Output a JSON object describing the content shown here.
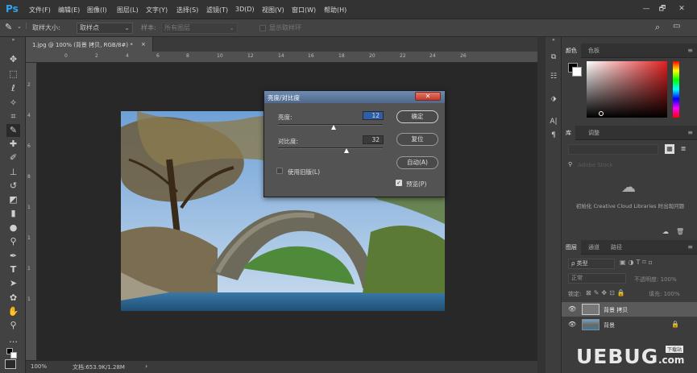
{
  "app": {
    "logo": "Ps"
  },
  "menu": [
    "文件(F)",
    "编辑(E)",
    "图像(I)",
    "图层(L)",
    "文字(Y)",
    "选择(S)",
    "滤镜(T)",
    "3D(D)",
    "视图(V)",
    "窗口(W)",
    "帮助(H)"
  ],
  "window_controls": {
    "minimize": "—",
    "restore": "🗗",
    "close": "✕"
  },
  "options_bar": {
    "sample_size_label": "取样大小:",
    "sample_size_value": "取样点",
    "sample_label": "样本:",
    "sample_value": "所有图层",
    "show_ring_label": "显示取样环"
  },
  "document_tab": {
    "title": "1.jpg @ 100% (背景 拷贝, RGB/8#) *",
    "close": "×"
  },
  "ruler": {
    "h_ticks": [
      "0",
      "2",
      "4",
      "6",
      "8",
      "10",
      "12",
      "14",
      "16",
      "18",
      "20",
      "22",
      "24",
      "26"
    ],
    "v_ticks": [
      "2",
      "4",
      "6",
      "8",
      "1",
      "1",
      "1",
      "1"
    ]
  },
  "status": {
    "zoom": "100%",
    "doc_info": "文档:653.9K/1.28M",
    "arrow": "›"
  },
  "dialog": {
    "title": "亮度/对比度",
    "close": "✕",
    "brightness_label": "亮度:",
    "brightness_value": "12",
    "contrast_label": "对比度:",
    "contrast_value": "32",
    "ok_label": "确定",
    "reset_label": "复位",
    "auto_label": "自动(A)",
    "legacy_label": "使用旧版(L)",
    "legacy_checked": false,
    "preview_label": "预览(P)",
    "preview_checked": true
  },
  "color_panel": {
    "tabs": [
      "颜色",
      "色板"
    ],
    "active_tab": "颜色",
    "hue_color": "#e02020"
  },
  "library_panel": {
    "tabs": [
      "库",
      "调整"
    ],
    "active_tab": "库",
    "search_placeholder": "Adobe Stock",
    "message": "初始化 Creative Cloud Libraries 时出现问题"
  },
  "layers_panel": {
    "tabs": [
      "图层",
      "通道",
      "路径"
    ],
    "active_tab": "图层",
    "kind_label": "ρ 类型",
    "blend_mode": "正常",
    "opacity_label": "不透明度: 100%",
    "lock_label": "锁定:",
    "fill_label": "填充: 100%",
    "layers": [
      {
        "name": "背景 拷贝",
        "selected": true,
        "locked": false
      },
      {
        "name": "背景",
        "selected": false,
        "locked": true
      }
    ]
  },
  "watermark": {
    "text": "UEBUG",
    "suffix": ".com",
    "tag": "下载站"
  }
}
